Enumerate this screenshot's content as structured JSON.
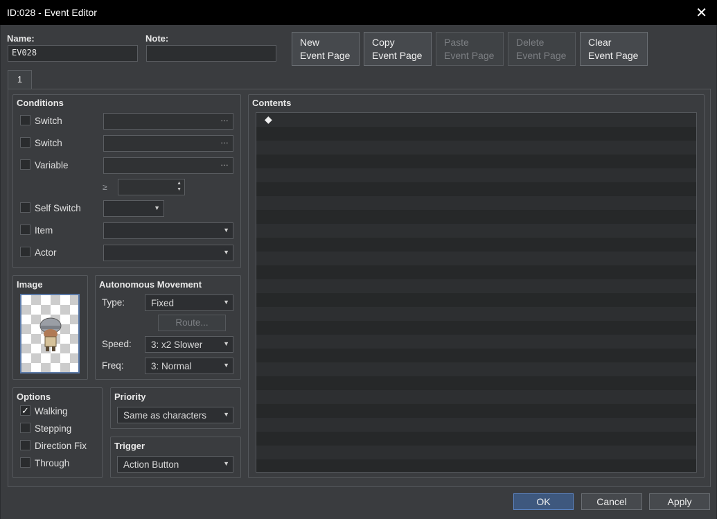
{
  "window": {
    "title": "ID:028 - Event Editor",
    "close_glyph": "✕"
  },
  "header": {
    "name_label": "Name:",
    "name_value": "EV028",
    "note_label": "Note:",
    "note_value": "",
    "buttons": [
      {
        "line1": "New",
        "line2": "Event Page",
        "disabled": false
      },
      {
        "line1": "Copy",
        "line2": "Event Page",
        "disabled": false
      },
      {
        "line1": "Paste",
        "line2": "Event Page",
        "disabled": true
      },
      {
        "line1": "Delete",
        "line2": "Event Page",
        "disabled": true
      },
      {
        "line1": "Clear",
        "line2": "Event Page",
        "disabled": false
      }
    ]
  },
  "tabs": [
    "1"
  ],
  "conditions": {
    "title": "Conditions",
    "switch1_label": "Switch",
    "switch2_label": "Switch",
    "variable_label": "Variable",
    "gte_glyph": "≥",
    "self_switch_label": "Self Switch",
    "item_label": "Item",
    "actor_label": "Actor",
    "dots": "…"
  },
  "image": {
    "title": "Image",
    "icon": "helmet-character-sprite"
  },
  "movement": {
    "title": "Autonomous Movement",
    "type_label": "Type:",
    "type_value": "Fixed",
    "route_label": "Route...",
    "speed_label": "Speed:",
    "speed_value": "3: x2 Slower",
    "freq_label": "Freq:",
    "freq_value": "3: Normal"
  },
  "options": {
    "title": "Options",
    "items": [
      {
        "label": "Walking",
        "checked": true
      },
      {
        "label": "Stepping",
        "checked": false
      },
      {
        "label": "Direction Fix",
        "checked": false
      },
      {
        "label": "Through",
        "checked": false
      }
    ]
  },
  "priority": {
    "title": "Priority",
    "value": "Same as characters"
  },
  "trigger": {
    "title": "Trigger",
    "value": "Action Button"
  },
  "contents": {
    "title": "Contents",
    "marker": "◆"
  },
  "footer": {
    "ok": "OK",
    "cancel": "Cancel",
    "apply": "Apply"
  }
}
